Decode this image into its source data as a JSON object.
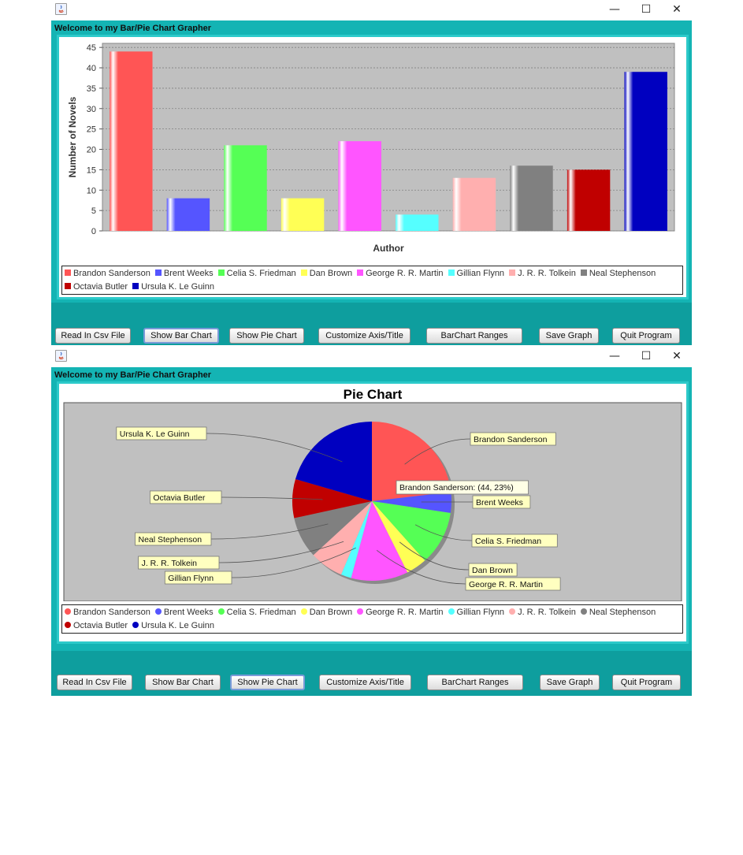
{
  "app": {
    "welcome": "Welcome to my Bar/Pie Chart Grapher",
    "window_controls": {
      "minimize": "—",
      "maximize": "☐",
      "close": "✕"
    }
  },
  "buttons": {
    "read_csv": "Read In Csv File",
    "show_bar": "Show Bar Chart",
    "show_pie": "Show Pie Chart",
    "customize": "Customize Axis/Title",
    "ranges": "BarChart  Ranges",
    "save": "Save Graph",
    "quit": "Quit Program"
  },
  "authors": [
    "Brandon Sanderson",
    "Brent Weeks",
    "Celia S. Friedman",
    "Dan Brown",
    "George R. R. Martin",
    "Gillian Flynn",
    "J. R. R. Tolkein",
    "Neal Stephenson",
    "Octavia Butler",
    "Ursula K. Le Guinn"
  ],
  "colors": [
    "#ff5555",
    "#5555ff",
    "#55ff55",
    "#ffff55",
    "#ff55ff",
    "#55ffff",
    "#ffafaf",
    "#808080",
    "#c00000",
    "#0000c0"
  ],
  "chart_data": [
    {
      "type": "bar",
      "title": "",
      "xlabel": "Author",
      "ylabel": "Number of Novels",
      "ylim": [
        0,
        46
      ],
      "yticks": [
        0,
        5,
        10,
        15,
        20,
        25,
        30,
        35,
        40,
        45
      ],
      "categories": [
        "Brandon Sanderson",
        "Brent Weeks",
        "Celia S. Friedman",
        "Dan Brown",
        "George R. R. Martin",
        "Gillian Flynn",
        "J. R. R. Tolkein",
        "Neal Stephenson",
        "Octavia Butler",
        "Ursula K. Le Guinn"
      ],
      "values": [
        44,
        8,
        21,
        8,
        22,
        4,
        13,
        16,
        15,
        39
      ],
      "grid": true,
      "legend": "bottom"
    },
    {
      "type": "pie",
      "title": "Pie Chart",
      "categories": [
        "Brandon Sanderson",
        "Brent Weeks",
        "Celia S. Friedman",
        "Dan Brown",
        "George R. R. Martin",
        "Gillian Flynn",
        "J. R. R. Tolkein",
        "Neal Stephenson",
        "Octavia Butler",
        "Ursula K. Le Guinn"
      ],
      "values": [
        44,
        8,
        21,
        8,
        22,
        4,
        13,
        16,
        15,
        39
      ],
      "tooltip": "Brandon Sanderson: (44, 23%)",
      "legend": "bottom"
    }
  ]
}
